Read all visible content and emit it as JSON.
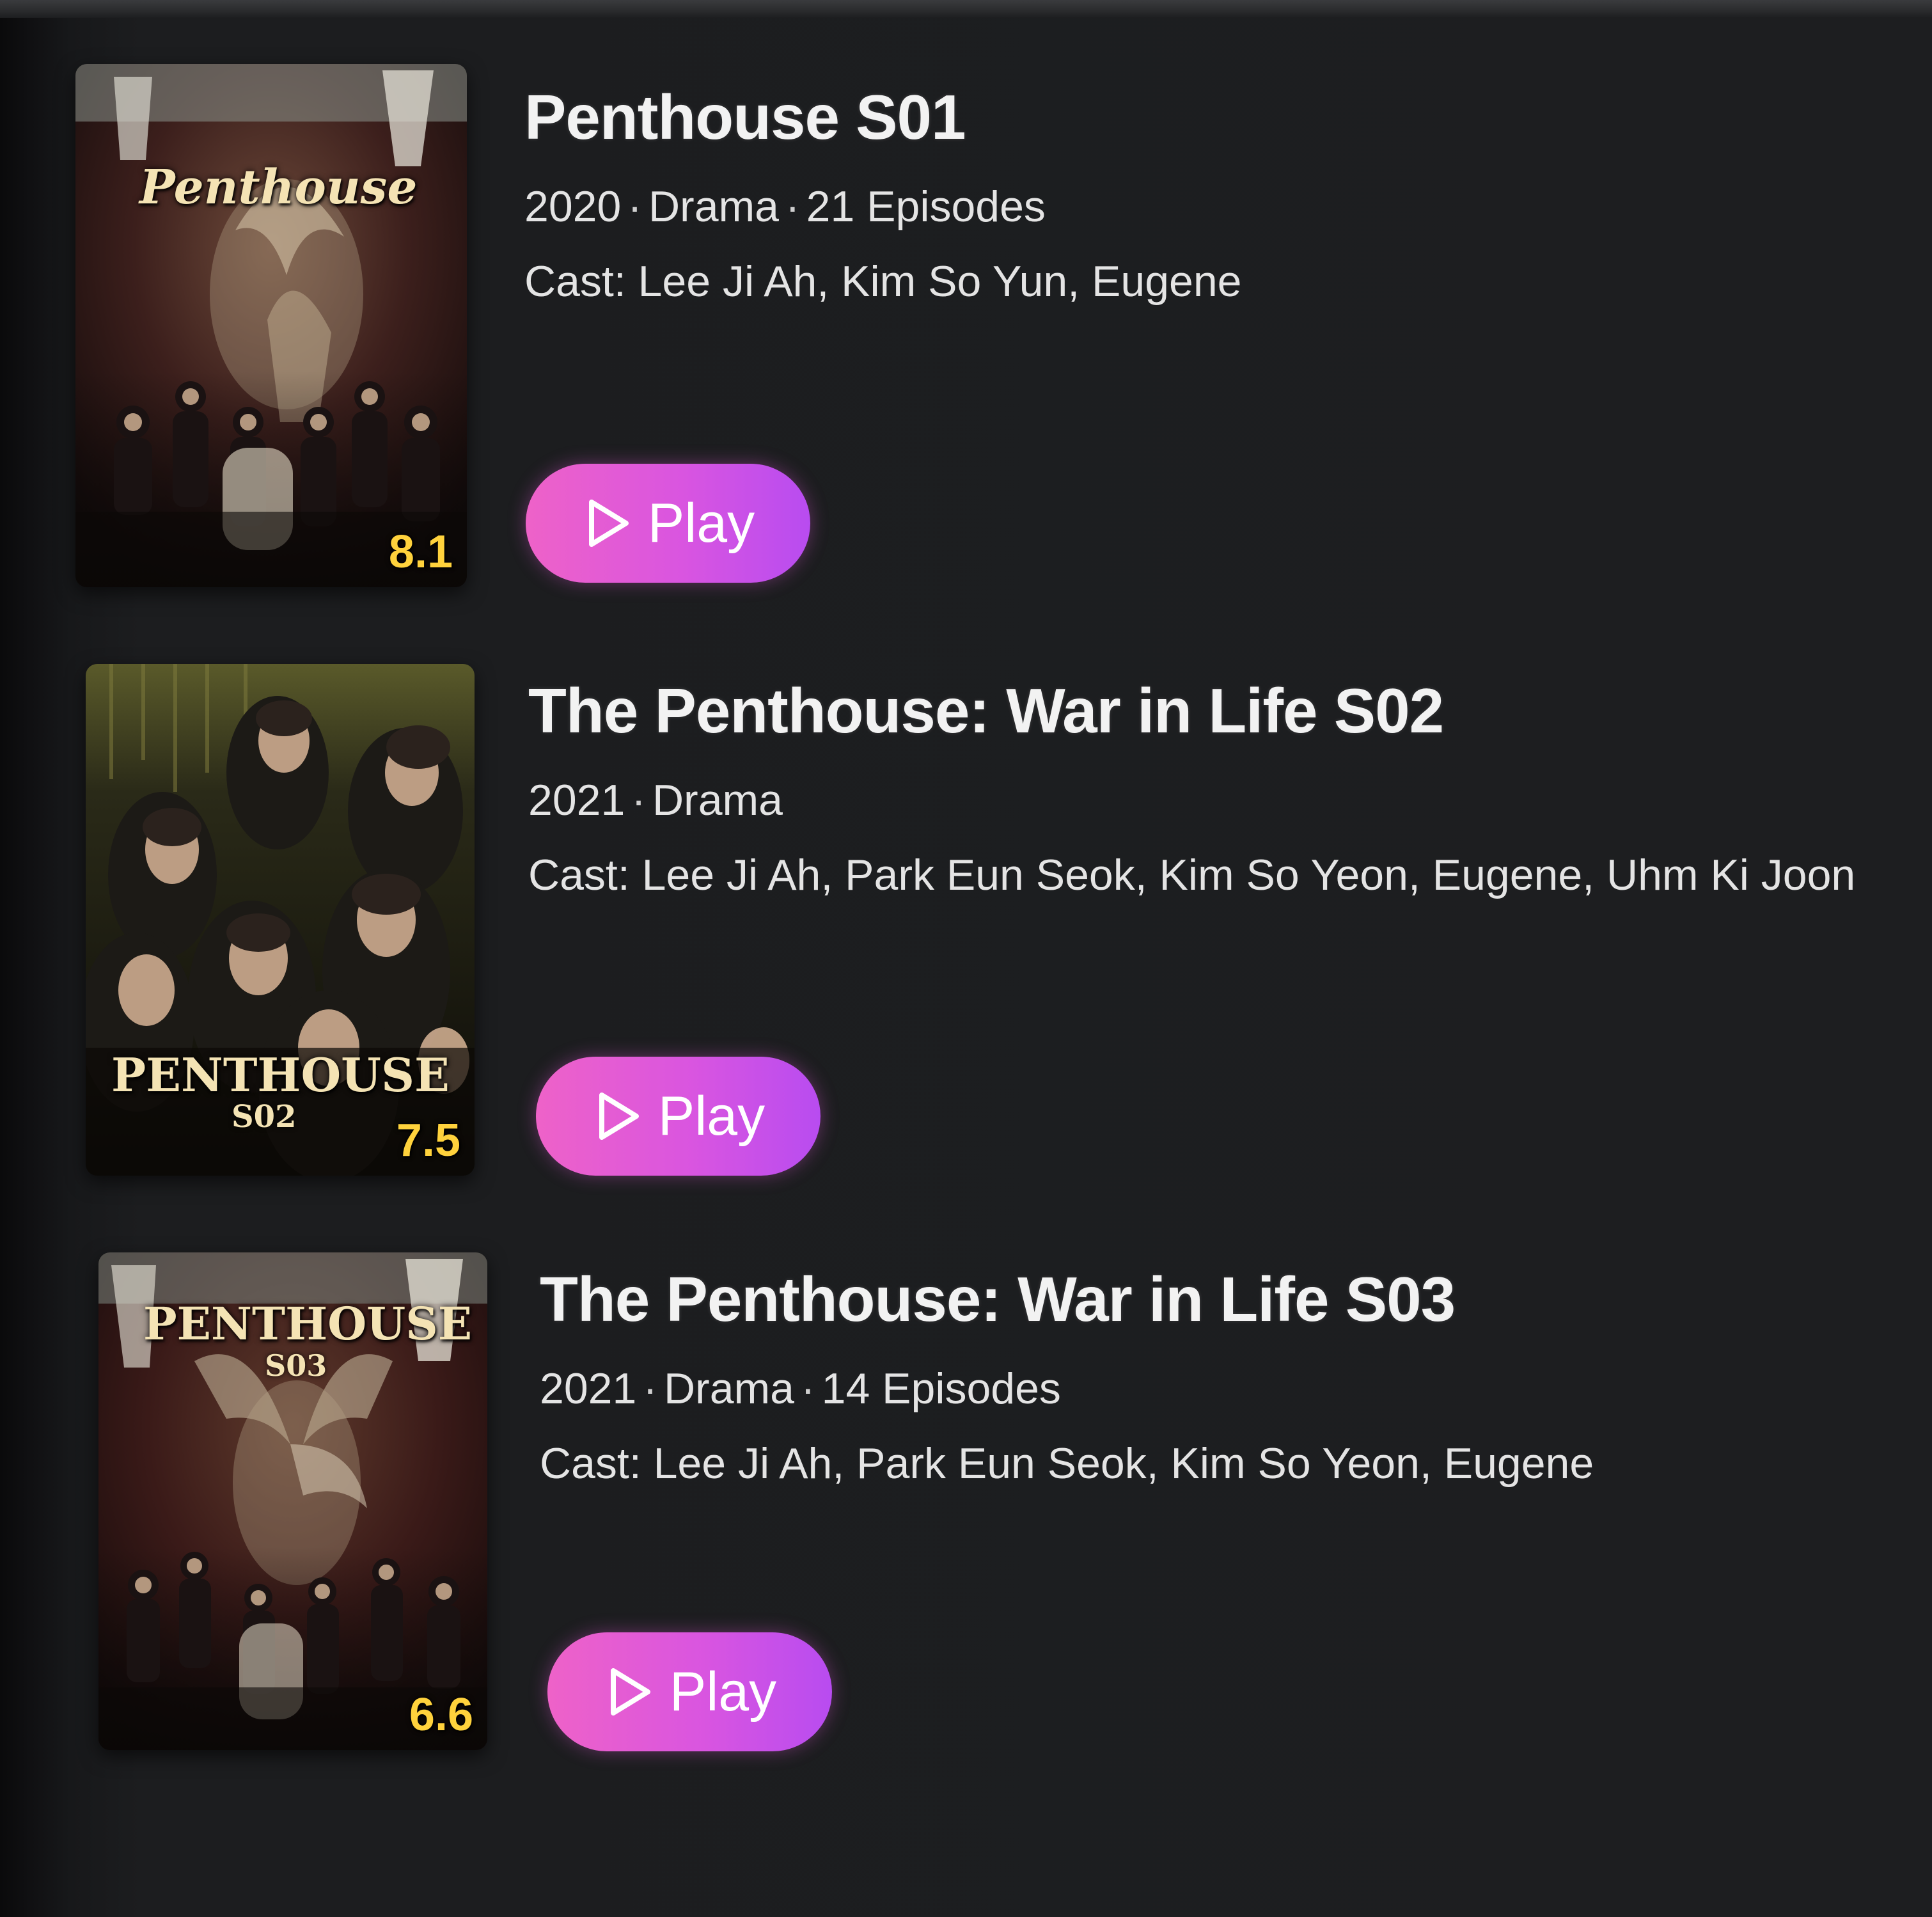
{
  "items": [
    {
      "title": "Penthouse S01",
      "year": "2020",
      "genre": "Drama",
      "episodes": "21 Episodes",
      "cast": "Cast: Lee Ji Ah, Kim So Yun, Eugene",
      "rating": "8.1",
      "poster_title": "Penthouse",
      "poster_season": "",
      "play_label": "Play"
    },
    {
      "title": "The Penthouse: War in Life S02",
      "year": "2021",
      "genre": "Drama",
      "episodes": "",
      "cast": "Cast: Lee Ji Ah, Park Eun Seok, Kim So Yeon, Eugene, Uhm Ki Joon",
      "rating": "7.5",
      "poster_title": "PENTHOUSE",
      "poster_season": "S02",
      "play_label": "Play"
    },
    {
      "title": "The Penthouse: War in Life S03",
      "year": "2021",
      "genre": "Drama",
      "episodes": "14 Episodes",
      "cast": "Cast: Lee Ji Ah, Park Eun Seok, Kim So Yeon, Eugene",
      "rating": "6.6",
      "poster_title": "PENTHOUSE",
      "poster_season": "S03",
      "play_label": "Play"
    }
  ],
  "meta_separator": "·",
  "icons": {
    "play": "play-icon"
  },
  "colors": {
    "background": "#1d1e20",
    "play_gradient_start": "#ee62c8",
    "play_gradient_end": "#b84cf0",
    "rating": "#ffd23c"
  }
}
